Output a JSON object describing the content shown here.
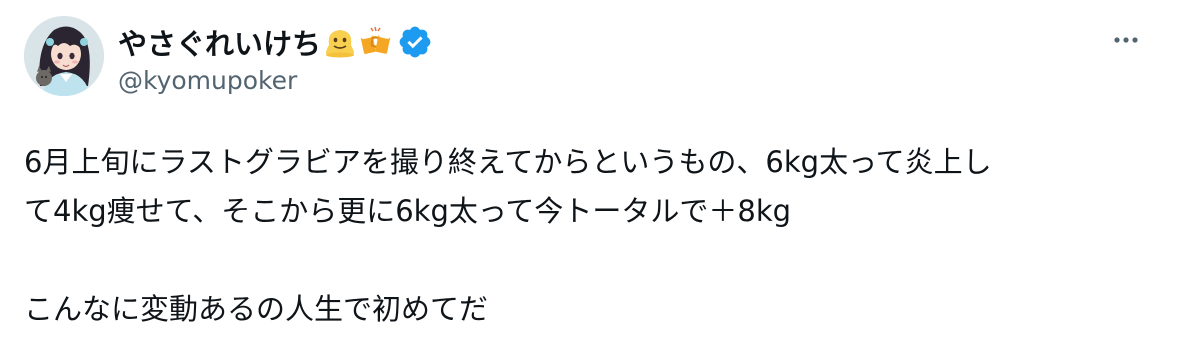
{
  "author": {
    "display_name": "やさぐれいけち",
    "handle": "@kyomupoker",
    "name_emojis": [
      "melting-face-emoji",
      "beer-mugs-emoji"
    ],
    "verified": true
  },
  "tweet": {
    "lines": [
      "6月上旬にラストグラビアを撮り終えてからというもの、6kg太って炎上し",
      "て4kg痩せて、そこから更に6kg太って今トータルで＋8kg",
      "",
      "こんなに変動あるの人生で初めてだ"
    ]
  },
  "colors": {
    "text": "#0f1419",
    "secondary": "#536471",
    "verified_blue": "#1d9bf0"
  },
  "icons": {
    "more": "more-horizontal-icon"
  }
}
